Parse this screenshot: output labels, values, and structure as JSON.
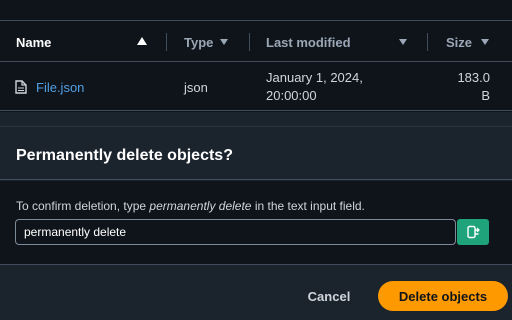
{
  "table": {
    "columns": [
      {
        "label": "Name"
      },
      {
        "label": "Type"
      },
      {
        "label": "Last modified"
      },
      {
        "label": "Size"
      }
    ],
    "rows": [
      {
        "name": "File.json",
        "type": "json",
        "modified_date": "January 1, 2024,",
        "modified_time": "20:00:00",
        "size_value": "183.0",
        "size_unit": "B",
        "icon": "file-icon"
      }
    ],
    "sort_column": "Name",
    "sort_direction": "ascending"
  },
  "modal": {
    "title": "Permanently delete objects?",
    "instruction_prefix": "To confirm deletion, type ",
    "instruction_phrase": "permanently delete",
    "instruction_suffix": " in the text input field.",
    "input_value": "permanently delete",
    "input_addon_icon": "clipboard-icon",
    "cancel_label": "Cancel",
    "delete_label": "Delete objects"
  },
  "colors": {
    "accent": "#ff9900",
    "link": "#539fe5",
    "addon": "#1fa37a"
  }
}
